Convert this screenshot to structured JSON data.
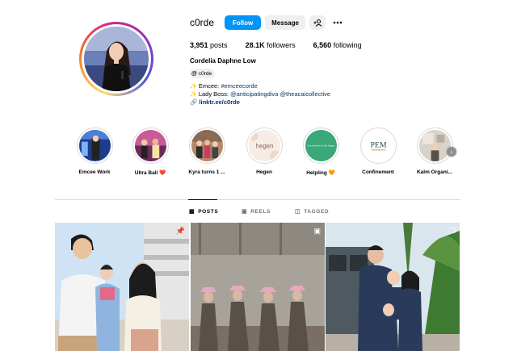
{
  "profile": {
    "username": "c0rde",
    "follow_label": "Follow",
    "message_label": "Message",
    "stats": {
      "posts": "3,951",
      "posts_label": "posts",
      "followers": "28.1K",
      "followers_label": "followers",
      "following": "6,560",
      "following_label": "following"
    },
    "full_name": "Cordelia Daphne Low",
    "threads_handle": "c0rde",
    "bio": {
      "line1_prefix": "Emcee: ",
      "line1_tag": "#emceecorde",
      "line2_prefix": "Lady Boss: ",
      "line2_mention1": "@anticipatingdiva",
      "line2_mention2": "@theacaicollective",
      "link": "linktr.ee/c0rde"
    }
  },
  "highlights": [
    {
      "label": "Emcee Work"
    },
    {
      "label": "Ultra Bali ❤️"
    },
    {
      "label": "Kyra turns 1 ..."
    },
    {
      "label": "Hegen"
    },
    {
      "label": "Helpling 🧡"
    },
    {
      "label": "Confinement"
    },
    {
      "label": "Kalm Organi..."
    }
  ],
  "highlight_texts": {
    "hegen": "hegen",
    "helpling": "You Deserve To Be Happy",
    "pem": "PEM"
  },
  "tabs": [
    {
      "label": "POSTS",
      "icon": "grid-icon"
    },
    {
      "label": "REELS",
      "icon": "reels-icon"
    },
    {
      "label": "TAGGED",
      "icon": "tag-icon"
    }
  ],
  "colors": {
    "accent": "#0095f6",
    "link": "#00376b",
    "button_gray": "#efefef"
  }
}
